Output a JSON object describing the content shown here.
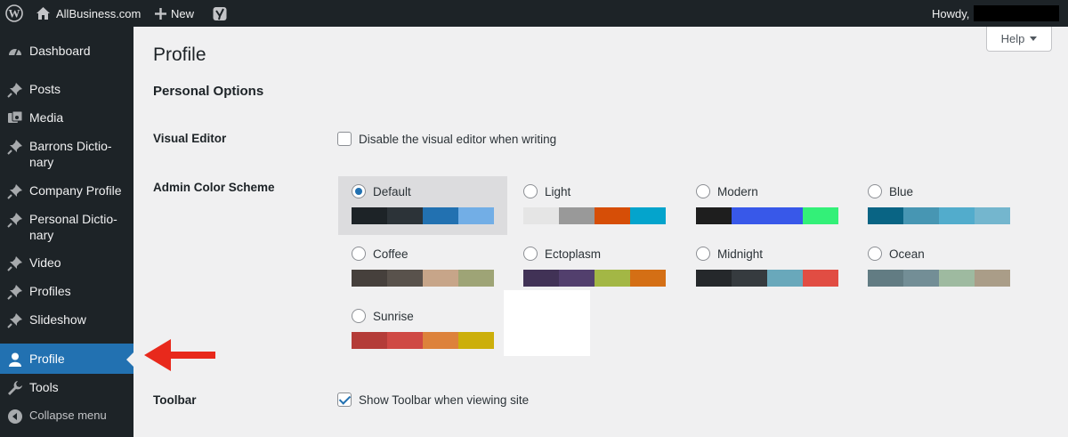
{
  "adminbar": {
    "site_name": "AllBusiness.com",
    "new_label": "New",
    "howdy": "Howdy,",
    "icons": [
      "wordpress-logo-icon",
      "home-icon",
      "plus-icon",
      "yoast-icon"
    ]
  },
  "sidebar": {
    "items": [
      {
        "label": "Dashboard",
        "icon": "dashboard-icon"
      },
      {
        "label": "Posts",
        "icon": "pin-icon"
      },
      {
        "label": "Media",
        "icon": "media-icon"
      },
      {
        "label": "Barrons Dictio­nary",
        "icon": "pin-icon"
      },
      {
        "label": "Company Profile",
        "icon": "pin-icon"
      },
      {
        "label": "Personal Dictio­nary",
        "icon": "pin-icon"
      },
      {
        "label": "Video",
        "icon": "pin-icon"
      },
      {
        "label": "Profiles",
        "icon": "pin-icon"
      },
      {
        "label": "Slideshow",
        "icon": "pin-icon"
      },
      {
        "label": "Profile",
        "icon": "user-icon"
      },
      {
        "label": "Tools",
        "icon": "wrench-icon"
      },
      {
        "label": "Collapse menu",
        "icon": "collapse-icon"
      }
    ],
    "current": "Profile",
    "menu_bg": "#1d2327",
    "accent": "#2271b1"
  },
  "main": {
    "help_label": "Help",
    "page_title": "Profile",
    "section_title": "Personal Options",
    "visual_editor": {
      "label": "Visual Editor",
      "checkbox_label": "Disable the visual editor when writing",
      "checked": false
    },
    "color_scheme": {
      "label": "Admin Color Scheme",
      "selected": "Default",
      "schemes": [
        {
          "name": "Default",
          "colors": [
            "#1d2327",
            "#2c3338",
            "#2271b1",
            "#72aee6"
          ]
        },
        {
          "name": "Light",
          "colors": [
            "#e5e5e5",
            "#999999",
            "#d64e07",
            "#04a4cc"
          ]
        },
        {
          "name": "Modern",
          "colors": [
            "#1e1e1e",
            "#3858e9",
            "#3858e9",
            "#33f078"
          ]
        },
        {
          "name": "Blue",
          "colors": [
            "#096484",
            "#4796b3",
            "#52accc",
            "#74b6ce"
          ]
        },
        {
          "name": "Coffee",
          "colors": [
            "#46403c",
            "#59524c",
            "#c7a589",
            "#9ea476"
          ]
        },
        {
          "name": "Ectoplasm",
          "colors": [
            "#413256",
            "#523f6d",
            "#a3b745",
            "#d46f15"
          ]
        },
        {
          "name": "Midnight",
          "colors": [
            "#25282b",
            "#363b3f",
            "#69a8bb",
            "#e14d43"
          ]
        },
        {
          "name": "Ocean",
          "colors": [
            "#627c83",
            "#738e96",
            "#9ebaa0",
            "#aa9d88"
          ]
        },
        {
          "name": "Sunrise",
          "colors": [
            "#b43c38",
            "#cf4944",
            "#dd823b",
            "#ccaf0b"
          ]
        }
      ]
    },
    "toolbar": {
      "label": "Toolbar",
      "checkbox_label": "Show Toolbar when viewing site",
      "checked": true
    }
  },
  "annotation": {
    "arrow_color": "#e8291c"
  }
}
